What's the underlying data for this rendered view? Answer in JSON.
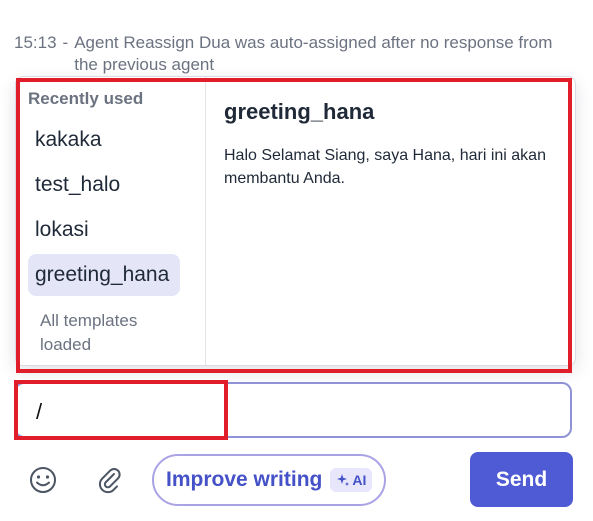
{
  "activity_log": {
    "time": "15:13",
    "separator": "-",
    "message": "Agent Reassign Dua was auto-assigned after no response from the previous agent"
  },
  "template_picker": {
    "recent_heading": "Recently used",
    "items": [
      {
        "label": "kakaka",
        "selected": false
      },
      {
        "label": "test_halo",
        "selected": false
      },
      {
        "label": "lokasi",
        "selected": false
      },
      {
        "label": "greeting_hana",
        "selected": true
      }
    ],
    "loaded_note": "All templates loaded",
    "preview": {
      "title": "greeting_hana",
      "body": "Halo Selamat Siang, saya Hana, hari ini akan membantu Anda."
    }
  },
  "composer": {
    "value": "/"
  },
  "toolbar": {
    "emoji_icon": "smiley-icon",
    "attach_icon": "paperclip-icon",
    "improve_label": "Improve writing",
    "ai_badge": "AI",
    "send_label": "Send"
  },
  "colors": {
    "accent": "#4f5bd5",
    "highlight": "#e11d2a",
    "selected_bg": "#e4e6f7"
  }
}
